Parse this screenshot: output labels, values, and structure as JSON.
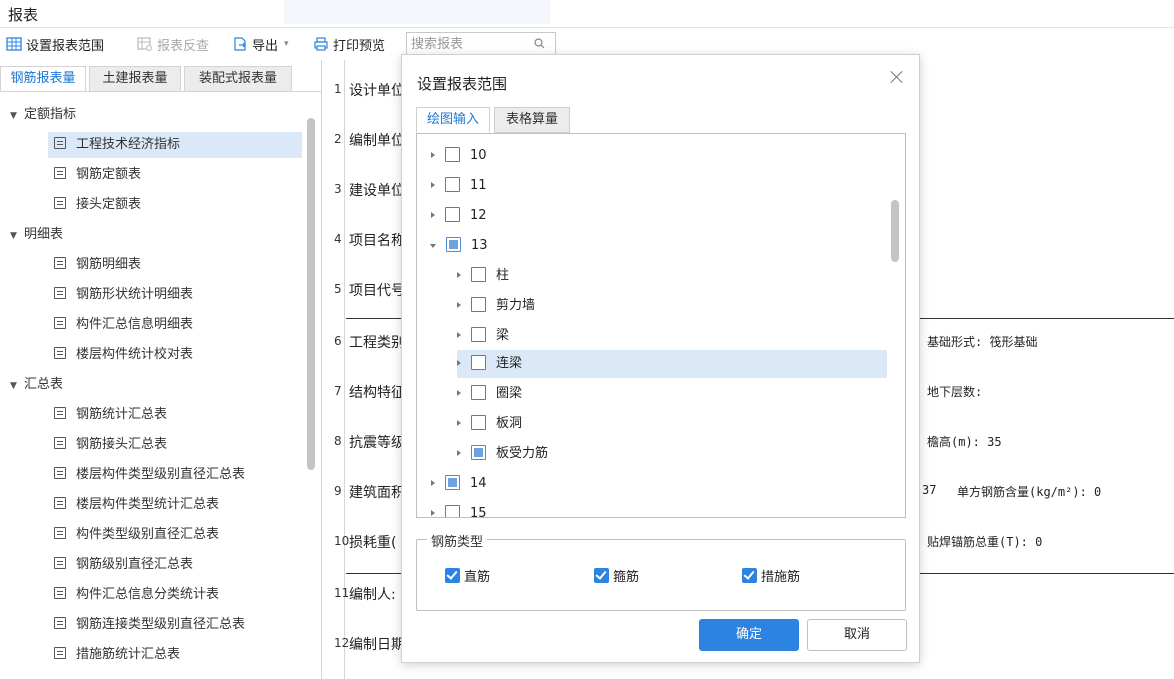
{
  "window": {
    "title": "报表"
  },
  "toolbar": {
    "set_range": "设置报表范围",
    "reverse_check": "报表反查",
    "export": "导出",
    "print_preview": "打印预览",
    "search_placeholder": "搜索报表"
  },
  "left_tabs": [
    "钢筋报表量",
    "土建报表量",
    "装配式报表量"
  ],
  "tree": {
    "groups": [
      "定额指标",
      "明细表",
      "汇总表"
    ],
    "quota": [
      "工程技术经济指标",
      "钢筋定额表",
      "接头定额表"
    ],
    "detail": [
      "钢筋明细表",
      "钢筋形状统计明细表",
      "构件汇总信息明细表",
      "楼层构件统计校对表"
    ],
    "summary": [
      "钢筋统计汇总表",
      "钢筋接头汇总表",
      "楼层构件类型级别直径汇总表",
      "楼层构件类型统计汇总表",
      "构件类型级别直径汇总表",
      "钢筋级别直径汇总表",
      "构件汇总信息分类统计表",
      "钢筋连接类型级别直径汇总表",
      "措施筋统计汇总表"
    ]
  },
  "report": {
    "rows": [
      {
        "num": "1",
        "label": "设计单位"
      },
      {
        "num": "2",
        "label": "编制单位"
      },
      {
        "num": "3",
        "label": "建设单位"
      },
      {
        "num": "4",
        "label": "项目名称"
      },
      {
        "num": "5",
        "label": "项目代号"
      },
      {
        "num": "6",
        "label": "工程类别"
      },
      {
        "num": "7",
        "label": "结构特征"
      },
      {
        "num": "8",
        "label": "抗震等级"
      },
      {
        "num": "9",
        "label": "建筑面积"
      },
      {
        "num": "10",
        "label": "损耗重("
      },
      {
        "num": "11",
        "label": "编制人:"
      },
      {
        "num": "12",
        "label": "编制日期"
      }
    ],
    "right": {
      "foundation": "基础形式: 筏形基础",
      "underground": "地下层数:",
      "eave": "檐高(m): 35",
      "area_suffix": "37",
      "steel_content": "单方钢筋含量(kg/m²): 0",
      "anchor": "贴焊锚筋总重(T): 0"
    }
  },
  "dialog": {
    "title": "设置报表范围",
    "tabs": [
      "绘图输入",
      "表格算量"
    ],
    "tree_items": [
      {
        "label": "10",
        "state": "unchecked"
      },
      {
        "label": "11",
        "state": "unchecked"
      },
      {
        "label": "12",
        "state": "unchecked"
      },
      {
        "label": "13",
        "state": "partial"
      },
      {
        "label": "柱",
        "state": "unchecked"
      },
      {
        "label": "剪力墙",
        "state": "unchecked"
      },
      {
        "label": "梁",
        "state": "unchecked"
      },
      {
        "label": "连梁",
        "state": "unchecked"
      },
      {
        "label": "圈梁",
        "state": "unchecked"
      },
      {
        "label": "板洞",
        "state": "unchecked"
      },
      {
        "label": "板受力筋",
        "state": "partial"
      },
      {
        "label": "14",
        "state": "partial"
      },
      {
        "label": "15",
        "state": "unchecked"
      }
    ],
    "steel_type_legend": "钢筋类型",
    "steel_types": [
      "直筋",
      "箍筋",
      "措施筋"
    ],
    "ok": "确定",
    "cancel": "取消"
  },
  "colors": {
    "accent": "#2d83e0",
    "selection": "#dbe8f7"
  }
}
